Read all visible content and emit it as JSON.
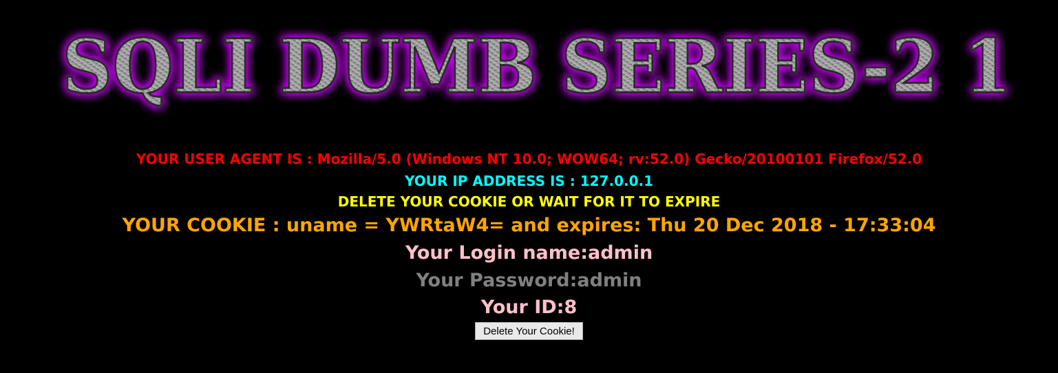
{
  "banner": {
    "title": "SQLI DUMB SERIES-2 1",
    "colors": {
      "glow": "#d000ff",
      "metal_light": "#c8c8c8",
      "metal_dark": "#6e6e6e",
      "outline": "#2a2a2a"
    }
  },
  "info": {
    "user_agent": "YOUR USER AGENT IS : Mozilla/5.0 (Windows NT 10.0; WOW64; rv:52.0) Gecko/20100101 Firefox/52.0",
    "ip_address": "YOUR IP ADDRESS IS : 127.0.0.1",
    "delete_notice": "DELETE YOUR COOKIE OR WAIT FOR IT TO EXPIRE",
    "cookie": "YOUR COOKIE : uname = YWRtaW4= and expires: Thu 20 Dec 2018 - 17:33:04",
    "login_name": "Your Login name:admin",
    "password": "Your Password:admin",
    "id": "Your ID:8"
  },
  "form": {
    "delete_button_label": "Delete Your Cookie!"
  },
  "colors": {
    "background": "#000000",
    "user_agent": "#ff0000",
    "ip_address": "#00ffff",
    "delete_notice": "#ffff00",
    "cookie": "#ffa500",
    "login_name": "#ffc0cb",
    "password": "#808080",
    "id": "#ffc0cb"
  }
}
